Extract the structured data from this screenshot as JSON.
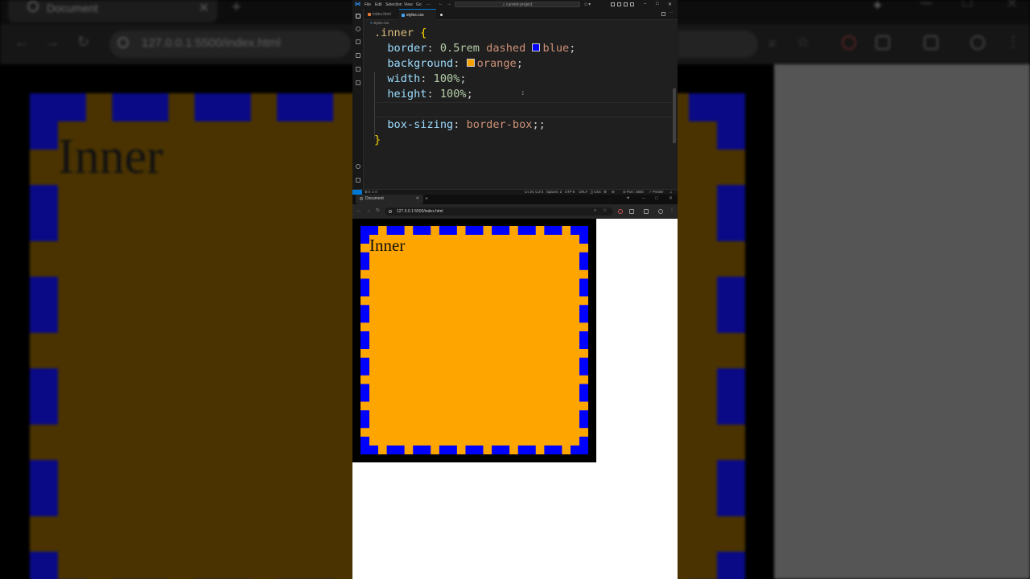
{
  "background_browser": {
    "tab_title": "Document",
    "url": "127.0.0.1:5500/index.html",
    "page_text": "Inner"
  },
  "vscode": {
    "menu": [
      "File",
      "Edit",
      "Selection",
      "View",
      "Go",
      "···"
    ],
    "search_placeholder": "current-project",
    "tabs": [
      {
        "label": "index.html",
        "icon_color": "#e37933",
        "active": false
      },
      {
        "label": "styles.css",
        "icon_color": "#42a5f5",
        "active": true
      }
    ],
    "breadcrumb": "styles.css",
    "code": {
      "selector": ".inner",
      "open_brace": "{",
      "close_brace": "}",
      "border_prop": "border",
      "border_num": "0.5rem",
      "border_style": "dashed",
      "border_color": "blue",
      "border_color_hex": "#0000ff",
      "bg_prop": "background",
      "bg_value": "orange",
      "bg_color_hex": "#f5a300",
      "width_prop": "width",
      "width_value": "100%",
      "height_prop": "height",
      "height_value": "100%",
      "boxsizing_prop": "box-sizing",
      "boxsizing_value": "border-box",
      "boxsizing_end": ";;",
      "colon": ":",
      "semicolon": ";"
    },
    "status": {
      "left": "⊗ 0 ⚠ 0",
      "position": "Ln 19, Col 3",
      "spaces": "Spaces: 2",
      "encoding": "UTF-8",
      "eol": "CRLF",
      "language": "{} CSS",
      "port": "⊘ Port : 5500",
      "prettier": "✓ Prettier"
    }
  },
  "browser": {
    "tab_title": "Document",
    "url": "127.0.0.1:5500/index.html"
  },
  "page": {
    "inner_text": "Inner"
  }
}
